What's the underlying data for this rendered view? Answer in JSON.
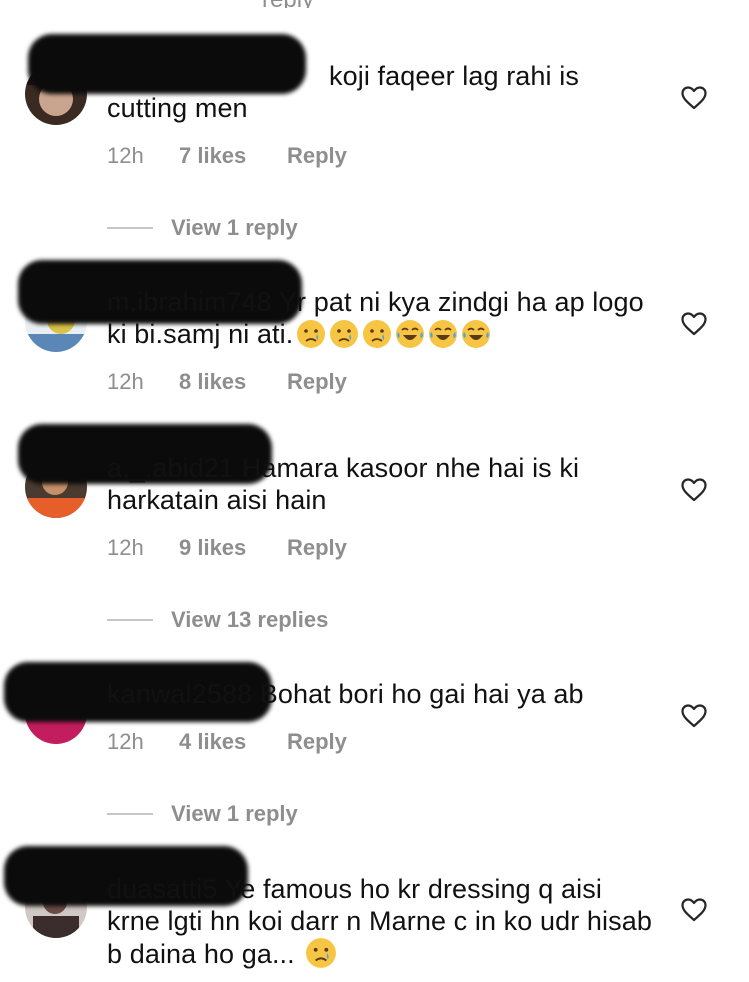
{
  "comments": [
    {
      "username": "",
      "text": "koji faqeer lag rahi is cutting men",
      "time": "12h",
      "likes": "7 likes",
      "reply_label": "Reply",
      "view_replies": "View 1 reply"
    },
    {
      "username": "m.ibrahim748",
      "text": "Yr pat ni kya zindgi ha ap logo ki bi.samj ni ati.",
      "time": "12h",
      "likes": "8 likes",
      "reply_label": "Reply"
    },
    {
      "username": "a._.abid21",
      "text": "Hamara kasoor nhe hai is ki harkatain aisi hain",
      "time": "12h",
      "likes": "9 likes",
      "reply_label": "Reply",
      "view_replies": "View 13 replies"
    },
    {
      "username": "kanwal2588",
      "text": "Bohat bori ho gai hai ya ab",
      "time": "12h",
      "likes": "4 likes",
      "reply_label": "Reply",
      "view_replies": "View 1 reply"
    },
    {
      "username": "duasatti5",
      "text": "Ye famous ho kr dressing q aisi krne lgti hn koi darr n Marne c in ko udr hisab b daina ho ga...",
      "time": "",
      "likes": "",
      "reply_label": ""
    }
  ],
  "top_partial_text": "reply",
  "colors": {
    "text": "#111111",
    "secondary": "#8e8e8e",
    "divider": "#c7c7c7",
    "redaction": "#0b0b0b"
  },
  "icons": {
    "like": "heart-outline-icon",
    "crying": "crying-face-emoji",
    "laughing": "tears-of-joy-emoji"
  }
}
